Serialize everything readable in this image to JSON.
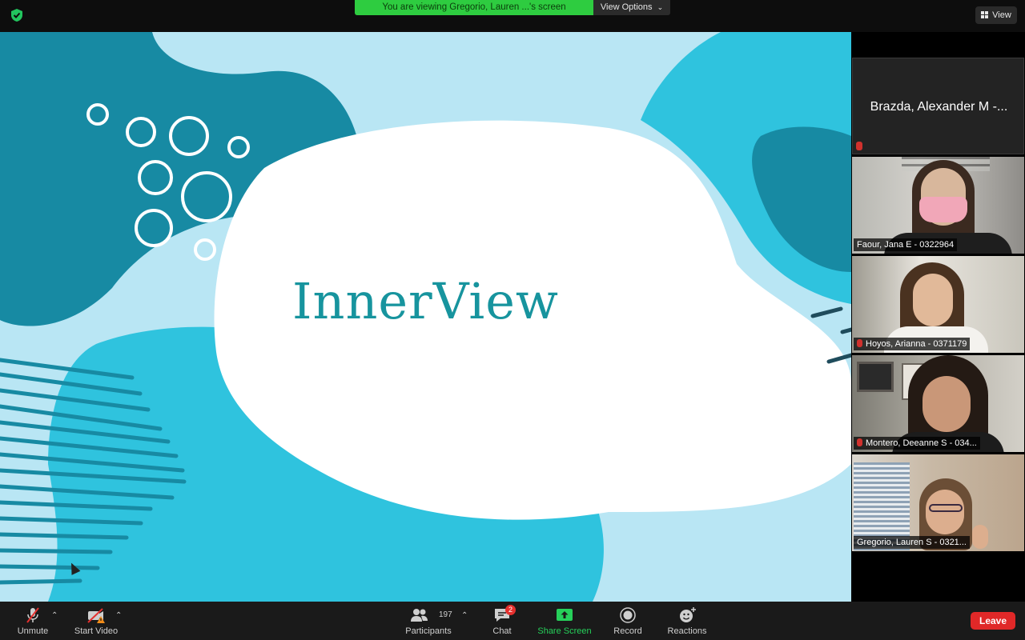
{
  "top_bar": {
    "viewing_banner": "You are viewing Gregorio, Lauren ...'s screen",
    "view_options": "View Options",
    "view_button": "View"
  },
  "slide": {
    "title": "InnerView"
  },
  "gallery": [
    {
      "name": "Brazda, Alexander M -...",
      "muted": true,
      "video": false
    },
    {
      "name": "Faour, Jana E - 0322964",
      "muted": false,
      "video": true
    },
    {
      "name": "Hoyos, Arianna - 0371179",
      "muted": true,
      "video": true
    },
    {
      "name": "Montero, Deeanne S - 034...",
      "muted": true,
      "video": true
    },
    {
      "name": "Gregorio, Lauren S - 0321...",
      "muted": false,
      "video": true,
      "active": true
    }
  ],
  "toolbar": {
    "unmute": "Unmute",
    "start_video": "Start Video",
    "participants": "Participants",
    "participants_count": "197",
    "chat": "Chat",
    "chat_badge": "2",
    "share_screen": "Share Screen",
    "record": "Record",
    "reactions": "Reactions",
    "leave": "Leave"
  },
  "colors": {
    "banner_green": "#2ecc40",
    "slide_teal": "#17949e",
    "leave_red": "#e02828",
    "active_outline": "#c7e05a"
  },
  "icons": [
    "shield-icon",
    "chevron-down-icon",
    "grid-icon",
    "microphone-muted-icon",
    "camera-off-icon",
    "warning-icon",
    "participants-icon",
    "chat-icon",
    "share-screen-icon",
    "record-icon",
    "reactions-icon"
  ]
}
